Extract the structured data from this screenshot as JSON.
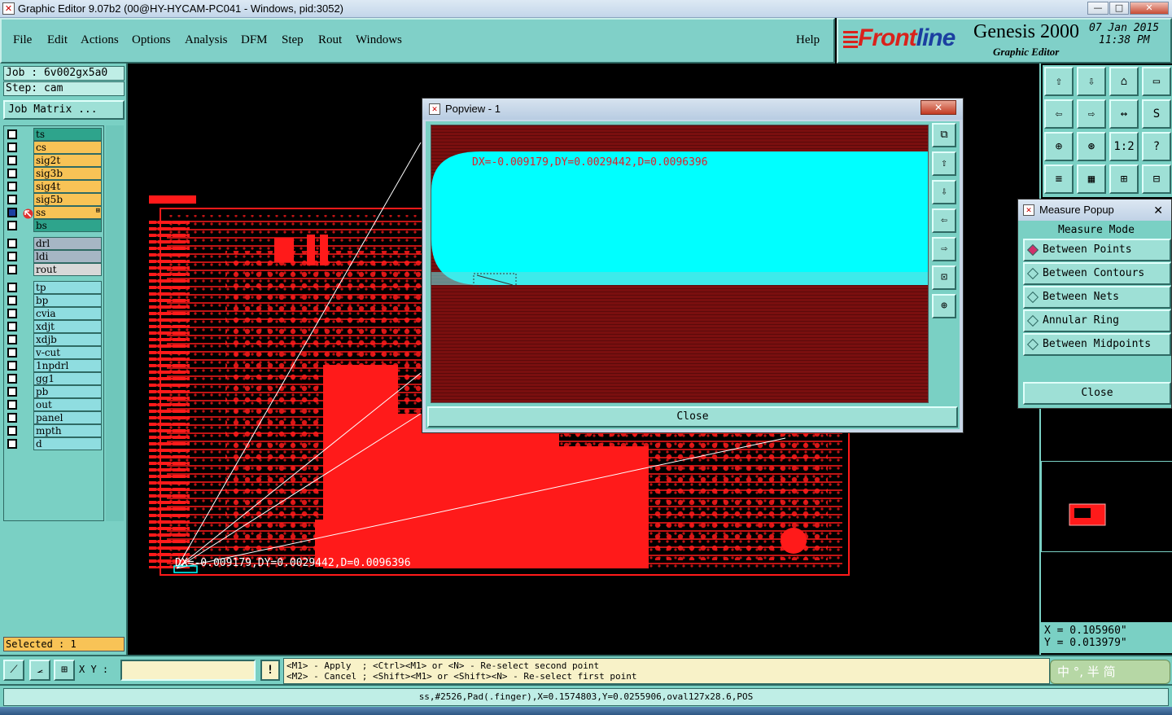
{
  "window": {
    "title": "Graphic Editor 9.07b2 (00@HY-HYCAM-PC041 - Windows, pid:3052)",
    "minimize": "—",
    "maximize": "□",
    "close": "✕"
  },
  "menu": {
    "items": [
      "File",
      "Edit",
      "Actions",
      "Options",
      "Analysis",
      "DFM",
      "Step",
      "Rout",
      "Windows"
    ],
    "help": "Help"
  },
  "brand": {
    "logo_prefix": "Front",
    "logo_suffix": "line",
    "product": "Genesis 2000",
    "subtitle": "Graphic Editor",
    "date": "07 Jan 2015",
    "time": "11:38 PM"
  },
  "job": {
    "job_label": "Job  : 6v002gx5a0",
    "step_label": "Step: cam",
    "matrix_button": "Job Matrix ..."
  },
  "layers": [
    {
      "name": "ts",
      "color": "#2ea48c"
    },
    {
      "name": "cs",
      "color": "#f8c356"
    },
    {
      "name": "sig2t",
      "color": "#f8c356"
    },
    {
      "name": "sig3b",
      "color": "#f8c356"
    },
    {
      "name": "sig4t",
      "color": "#f8c356"
    },
    {
      "name": "sig5b",
      "color": "#f8c356"
    },
    {
      "name": "ss",
      "color": "#f8c356",
      "work": true,
      "tag": "⊞"
    },
    {
      "name": "bs",
      "color": "#2ea48c"
    },
    {
      "name": "drl",
      "color": "#a6b6c4"
    },
    {
      "name": "ldi",
      "color": "#a6b6c4"
    },
    {
      "name": "rout",
      "color": "#d8d8d8"
    },
    {
      "name": "tp",
      "color": "#8fdde0"
    },
    {
      "name": "bp",
      "color": "#8fdde0"
    },
    {
      "name": "cvia",
      "color": "#8fdde0"
    },
    {
      "name": "xdjt",
      "color": "#8fdde0"
    },
    {
      "name": "xdjb",
      "color": "#8fdde0"
    },
    {
      "name": "v-cut",
      "color": "#8fdde0"
    },
    {
      "name": "1npdrl",
      "color": "#8fdde0"
    },
    {
      "name": "gg1",
      "color": "#8fdde0"
    },
    {
      "name": "pb",
      "color": "#8fdde0"
    },
    {
      "name": "out",
      "color": "#8fdde0"
    },
    {
      "name": "panel",
      "color": "#8fdde0"
    },
    {
      "name": "mpth",
      "color": "#8fdde0"
    },
    {
      "name": "d",
      "color": "#8fdde0"
    }
  ],
  "selected": "Selected : 1",
  "canvas": {
    "measure_text": "DX=-0.009179,DY=0.0029442,D=0.0096396"
  },
  "popview": {
    "title": "Popview - 1",
    "measure_text": "DX=-0.009179,DY=0.0029442,D=0.0096396",
    "close": "Close"
  },
  "measure_popup": {
    "title": "Measure Popup",
    "mode_label": "Measure Mode",
    "options": [
      {
        "label": "Between Points",
        "active": true
      },
      {
        "label": "Between Contours",
        "active": false
      },
      {
        "label": "Between Nets",
        "active": false
      },
      {
        "label": "Annular Ring",
        "active": false
      },
      {
        "label": "Between Midpoints",
        "active": false
      }
    ],
    "close": "Close"
  },
  "toolbar_right": [
    "⇧",
    "⇩",
    "⌂",
    "▭",
    "⇦",
    "⇨",
    "↔",
    "S",
    "⊕",
    "⊛",
    "1:2",
    "?",
    "≡",
    "▦",
    "⊞",
    "⊟"
  ],
  "coords": {
    "x": "X = 0.105960\"",
    "y": "Y = 0.013979\""
  },
  "command": {
    "xy_label": "X Y :",
    "xy_value": "",
    "bang": "!",
    "hint_line1": "<M1> - Apply  ; <Ctrl><M1> or <N> - Re-select second point",
    "hint_line2": "<M2> - Cancel ; <Shift><M1> or <Shift><N> - Re-select first point",
    "ime": "中 °, 半 简"
  },
  "status": "ss,#2526,Pad(.finger),X=0.1574803,Y=0.0255906,oval127x28.6,POS",
  "colors": {
    "panel": "#7ad0c4",
    "copper": "#ff1a1a",
    "highlight": "#00ffff"
  }
}
